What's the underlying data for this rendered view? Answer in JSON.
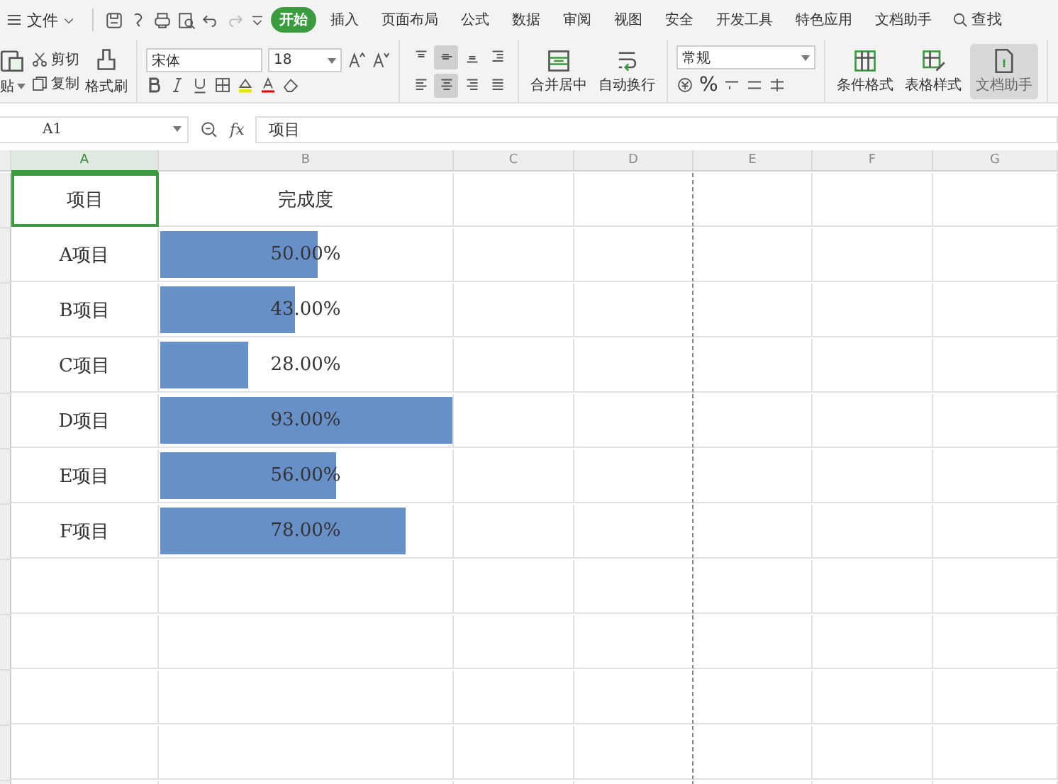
{
  "menu": {
    "file": "文件",
    "tabs": [
      {
        "label": "开始",
        "selected": true
      },
      {
        "label": "插入",
        "selected": false
      },
      {
        "label": "页面布局",
        "selected": false
      },
      {
        "label": "公式",
        "selected": false
      },
      {
        "label": "数据",
        "selected": false
      },
      {
        "label": "审阅",
        "selected": false
      },
      {
        "label": "视图",
        "selected": false
      },
      {
        "label": "安全",
        "selected": false
      },
      {
        "label": "开发工具",
        "selected": false
      },
      {
        "label": "特色应用",
        "selected": false
      },
      {
        "label": "文档助手",
        "selected": false
      }
    ],
    "search": "查找"
  },
  "ribbon": {
    "paste": "贴",
    "cut": "剪切",
    "copy": "复制",
    "format_painter": "格式刷",
    "font": "宋体",
    "size": "18",
    "merge": "合并居中",
    "wrap": "自动换行",
    "number_format": "常规",
    "percent": "%",
    "cond_format": "条件格式",
    "table_style": "表格样式",
    "doc_helper": "文档助手",
    "align_rows": [
      [
        {
          "kind": "top",
          "selected": false
        },
        {
          "kind": "middle",
          "selected": true
        },
        {
          "kind": "bottom",
          "selected": false
        },
        {
          "kind": "indent",
          "selected": false
        }
      ],
      [
        {
          "kind": "left",
          "selected": false
        },
        {
          "kind": "center",
          "selected": true
        },
        {
          "kind": "right",
          "selected": false
        },
        {
          "kind": "justify",
          "selected": false
        }
      ]
    ]
  },
  "formula_bar": {
    "cell_ref": "A1",
    "fx": "fx",
    "value": "项目"
  },
  "sheet": {
    "columns": [
      {
        "label": "A",
        "selected": true
      },
      {
        "label": "B",
        "selected": false
      },
      {
        "label": "C",
        "selected": false
      },
      {
        "label": "D",
        "selected": false
      },
      {
        "label": "E",
        "selected": false
      },
      {
        "label": "F",
        "selected": false
      },
      {
        "label": "G",
        "selected": false
      }
    ],
    "header": [
      "项目",
      "完成度"
    ],
    "rows": [
      {
        "name": "A项目",
        "value": "50.00%",
        "level": 0.538
      },
      {
        "name": "B项目",
        "value": "43.00%",
        "level": 0.462
      },
      {
        "name": "C项目",
        "value": "28.00%",
        "level": 0.301
      },
      {
        "name": "D项目",
        "value": "93.00%",
        "level": 1.0
      },
      {
        "name": "E项目",
        "value": "56.00%",
        "level": 0.602
      },
      {
        "name": "F项目",
        "value": "78.00%",
        "level": 0.839
      }
    ]
  }
}
